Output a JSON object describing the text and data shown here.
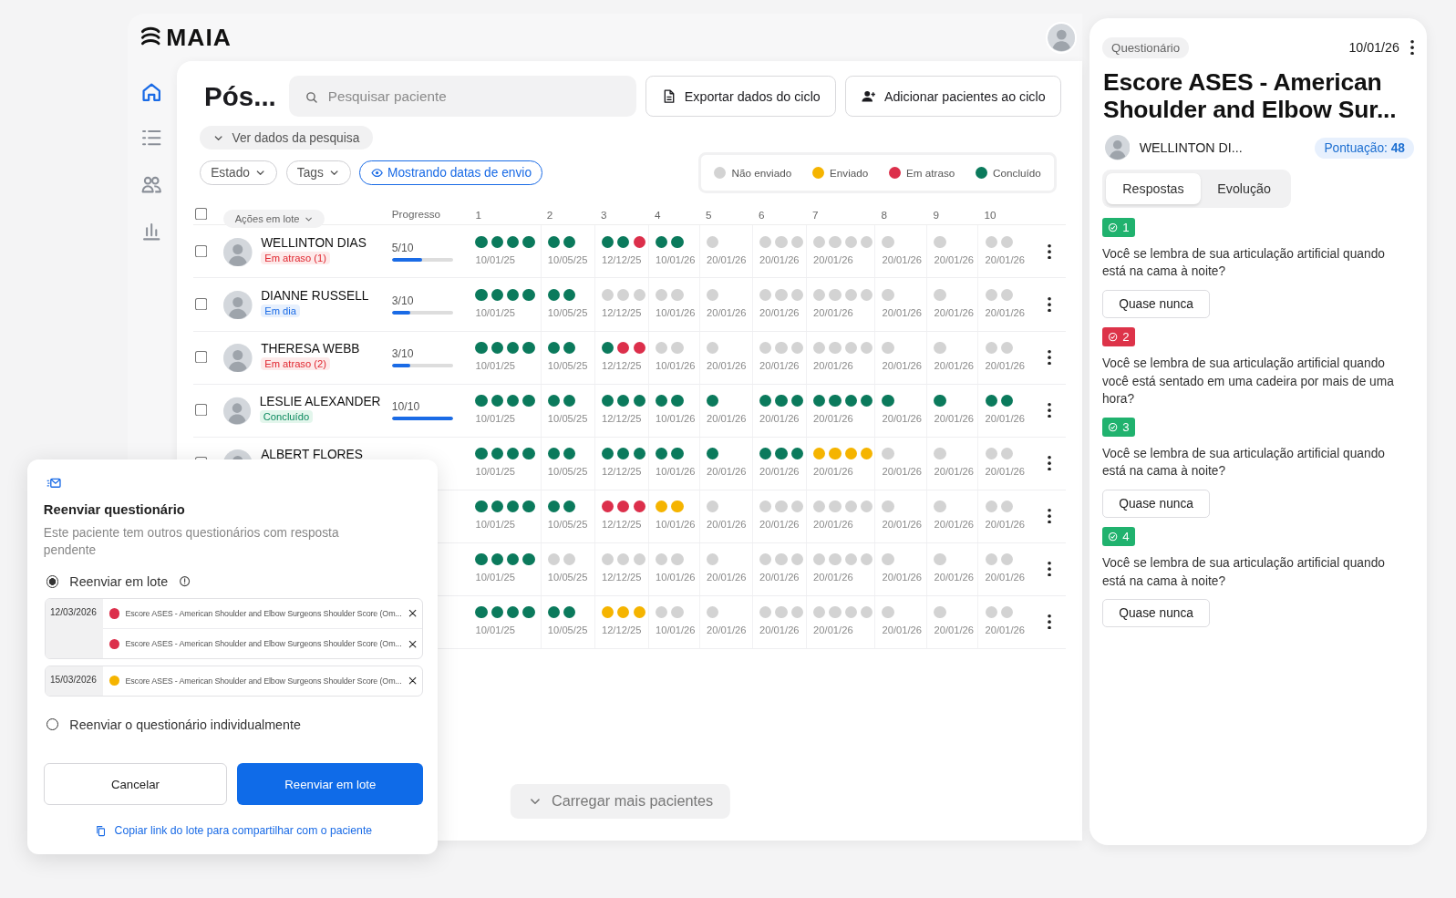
{
  "app": {
    "brand": "MAIA",
    "nav": [
      {
        "kind": "home",
        "selected": true
      },
      {
        "kind": "list",
        "selected": false
      },
      {
        "kind": "users",
        "selected": false
      },
      {
        "kind": "chart",
        "selected": false
      }
    ]
  },
  "main": {
    "title": "Pós...",
    "search": {
      "placeholder": "Pesquisar paciente"
    },
    "actions": [
      {
        "kind": "export",
        "label": "Exportar dados do ciclo"
      },
      {
        "kind": "add",
        "label": "Adicionar pacientes ao ciclo"
      }
    ],
    "survey_toggle": "Ver dados da pesquisa",
    "filters": [
      {
        "kind": "dropdown",
        "label": "Estado",
        "selected": false
      },
      {
        "kind": "dropdown",
        "label": "Tags",
        "selected": false
      },
      {
        "kind": "toggle",
        "label": "Mostrando datas de envio",
        "selected": true
      }
    ],
    "legend": [
      {
        "kind": "none",
        "label": "Não enviado",
        "color": "#d3d3d3"
      },
      {
        "kind": "sent",
        "label": "Enviado",
        "color": "#f5b400"
      },
      {
        "kind": "late",
        "label": "Em atraso",
        "color": "#dc2f4b"
      },
      {
        "kind": "done",
        "label": "Concluído",
        "color": "#0b7a5c"
      }
    ],
    "table": {
      "bulk_checked": false,
      "bulk_actions": "Ações em lote",
      "progress_header": "Progresso",
      "steps": [
        "1",
        "2",
        "3",
        "4",
        "5",
        "6",
        "7",
        "8",
        "9",
        "10"
      ],
      "rows": [
        {
          "name": "WELLINTON DIAS",
          "checked": false,
          "status": {
            "kind": "late",
            "label": "Em atraso (1)"
          },
          "progress": {
            "text": "5/10",
            "level": 0.5
          },
          "cells": [
            {
              "date": "10/01/25",
              "dots": [
                {
                  "kind": "done"
                },
                {
                  "kind": "done"
                },
                {
                  "kind": "done"
                },
                {
                  "kind": "done"
                }
              ]
            },
            {
              "date": "10/05/25",
              "dots": [
                {
                  "kind": "done"
                },
                {
                  "kind": "done"
                }
              ]
            },
            {
              "date": "12/12/25",
              "dots": [
                {
                  "kind": "done"
                },
                {
                  "kind": "done"
                },
                {
                  "kind": "late"
                }
              ]
            },
            {
              "date": "10/01/26",
              "dots": [
                {
                  "kind": "done"
                },
                {
                  "kind": "done"
                }
              ]
            },
            {
              "date": "20/01/26",
              "dots": [
                {
                  "kind": "none"
                }
              ]
            },
            {
              "date": "20/01/26",
              "dots": [
                {
                  "kind": "none"
                },
                {
                  "kind": "none"
                },
                {
                  "kind": "none"
                }
              ]
            },
            {
              "date": "20/01/26",
              "dots": [
                {
                  "kind": "none"
                },
                {
                  "kind": "none"
                },
                {
                  "kind": "none"
                },
                {
                  "kind": "none"
                }
              ]
            },
            {
              "date": "20/01/26",
              "dots": [
                {
                  "kind": "none"
                }
              ]
            },
            {
              "date": "20/01/26",
              "dots": [
                {
                  "kind": "none"
                }
              ]
            },
            {
              "date": "20/01/26",
              "dots": [
                {
                  "kind": "none"
                },
                {
                  "kind": "none"
                }
              ]
            }
          ]
        },
        {
          "name": "DIANNE RUSSELL",
          "checked": false,
          "status": {
            "kind": "on_time",
            "label": "Em dia"
          },
          "progress": {
            "text": "3/10",
            "level": 0.3
          },
          "cells": [
            {
              "date": "10/01/25",
              "dots": [
                {
                  "kind": "done"
                },
                {
                  "kind": "done"
                },
                {
                  "kind": "done"
                },
                {
                  "kind": "done"
                }
              ]
            },
            {
              "date": "10/05/25",
              "dots": [
                {
                  "kind": "done"
                },
                {
                  "kind": "done"
                }
              ]
            },
            {
              "date": "12/12/25",
              "dots": [
                {
                  "kind": "none"
                },
                {
                  "kind": "none"
                },
                {
                  "kind": "none"
                }
              ]
            },
            {
              "date": "10/01/26",
              "dots": [
                {
                  "kind": "none"
                },
                {
                  "kind": "none"
                }
              ]
            },
            {
              "date": "20/01/26",
              "dots": [
                {
                  "kind": "none"
                }
              ]
            },
            {
              "date": "20/01/26",
              "dots": [
                {
                  "kind": "none"
                },
                {
                  "kind": "none"
                },
                {
                  "kind": "none"
                }
              ]
            },
            {
              "date": "20/01/26",
              "dots": [
                {
                  "kind": "none"
                },
                {
                  "kind": "none"
                },
                {
                  "kind": "none"
                },
                {
                  "kind": "none"
                }
              ]
            },
            {
              "date": "20/01/26",
              "dots": [
                {
                  "kind": "none"
                }
              ]
            },
            {
              "date": "20/01/26",
              "dots": [
                {
                  "kind": "none"
                }
              ]
            },
            {
              "date": "20/01/26",
              "dots": [
                {
                  "kind": "none"
                },
                {
                  "kind": "none"
                }
              ]
            }
          ]
        },
        {
          "name": "THERESA WEBB",
          "checked": false,
          "status": {
            "kind": "late",
            "label": "Em atraso (2)"
          },
          "progress": {
            "text": "3/10",
            "level": 0.3
          },
          "cells": [
            {
              "date": "10/01/25",
              "dots": [
                {
                  "kind": "done"
                },
                {
                  "kind": "done"
                },
                {
                  "kind": "done"
                },
                {
                  "kind": "done"
                }
              ]
            },
            {
              "date": "10/05/25",
              "dots": [
                {
                  "kind": "done"
                },
                {
                  "kind": "done"
                }
              ]
            },
            {
              "date": "12/12/25",
              "dots": [
                {
                  "kind": "done"
                },
                {
                  "kind": "late"
                },
                {
                  "kind": "late"
                }
              ]
            },
            {
              "date": "10/01/26",
              "dots": [
                {
                  "kind": "none"
                },
                {
                  "kind": "none"
                }
              ]
            },
            {
              "date": "20/01/26",
              "dots": [
                {
                  "kind": "none"
                }
              ]
            },
            {
              "date": "20/01/26",
              "dots": [
                {
                  "kind": "none"
                },
                {
                  "kind": "none"
                },
                {
                  "kind": "none"
                }
              ]
            },
            {
              "date": "20/01/26",
              "dots": [
                {
                  "kind": "none"
                },
                {
                  "kind": "none"
                },
                {
                  "kind": "none"
                },
                {
                  "kind": "none"
                }
              ]
            },
            {
              "date": "20/01/26",
              "dots": [
                {
                  "kind": "none"
                }
              ]
            },
            {
              "date": "20/01/26",
              "dots": [
                {
                  "kind": "none"
                }
              ]
            },
            {
              "date": "20/01/26",
              "dots": [
                {
                  "kind": "none"
                },
                {
                  "kind": "none"
                }
              ]
            }
          ]
        },
        {
          "name": "LESLIE ALEXANDER",
          "checked": false,
          "status": {
            "kind": "done",
            "label": "Concluído"
          },
          "progress": {
            "text": "10/10",
            "level": 1
          },
          "cells": [
            {
              "date": "10/01/25",
              "dots": [
                {
                  "kind": "done"
                },
                {
                  "kind": "done"
                },
                {
                  "kind": "done"
                },
                {
                  "kind": "done"
                }
              ]
            },
            {
              "date": "10/05/25",
              "dots": [
                {
                  "kind": "done"
                },
                {
                  "kind": "done"
                }
              ]
            },
            {
              "date": "12/12/25",
              "dots": [
                {
                  "kind": "done"
                },
                {
                  "kind": "done"
                },
                {
                  "kind": "done"
                }
              ]
            },
            {
              "date": "10/01/26",
              "dots": [
                {
                  "kind": "done"
                },
                {
                  "kind": "done"
                }
              ]
            },
            {
              "date": "20/01/26",
              "dots": [
                {
                  "kind": "done"
                }
              ]
            },
            {
              "date": "20/01/26",
              "dots": [
                {
                  "kind": "done"
                },
                {
                  "kind": "done"
                },
                {
                  "kind": "done"
                }
              ]
            },
            {
              "date": "20/01/26",
              "dots": [
                {
                  "kind": "done"
                },
                {
                  "kind": "done"
                },
                {
                  "kind": "done"
                },
                {
                  "kind": "done"
                }
              ]
            },
            {
              "date": "20/01/26",
              "dots": [
                {
                  "kind": "done"
                }
              ]
            },
            {
              "date": "20/01/26",
              "dots": [
                {
                  "kind": "done"
                }
              ]
            },
            {
              "date": "20/01/26",
              "dots": [
                {
                  "kind": "done"
                },
                {
                  "kind": "done"
                }
              ]
            }
          ]
        },
        {
          "name": "ALBERT FLORES",
          "checked": false,
          "cells": [
            {
              "date": "10/01/25",
              "dots": [
                {
                  "kind": "done"
                },
                {
                  "kind": "done"
                },
                {
                  "kind": "done"
                },
                {
                  "kind": "done"
                }
              ]
            },
            {
              "date": "10/05/25",
              "dots": [
                {
                  "kind": "done"
                },
                {
                  "kind": "done"
                }
              ]
            },
            {
              "date": "12/12/25",
              "dots": [
                {
                  "kind": "done"
                },
                {
                  "kind": "done"
                },
                {
                  "kind": "done"
                }
              ]
            },
            {
              "date": "10/01/26",
              "dots": [
                {
                  "kind": "done"
                },
                {
                  "kind": "done"
                }
              ]
            },
            {
              "date": "20/01/26",
              "dots": [
                {
                  "kind": "done"
                }
              ]
            },
            {
              "date": "20/01/26",
              "dots": [
                {
                  "kind": "done"
                },
                {
                  "kind": "done"
                },
                {
                  "kind": "done"
                }
              ]
            },
            {
              "date": "20/01/26",
              "dots": [
                {
                  "kind": "sent"
                },
                {
                  "kind": "sent"
                },
                {
                  "kind": "sent"
                },
                {
                  "kind": "sent"
                }
              ]
            },
            {
              "date": "20/01/26",
              "dots": [
                {
                  "kind": "none"
                }
              ]
            },
            {
              "date": "20/01/26",
              "dots": [
                {
                  "kind": "none"
                }
              ]
            },
            {
              "date": "20/01/26",
              "dots": [
                {
                  "kind": "none"
                },
                {
                  "kind": "none"
                }
              ]
            }
          ]
        },
        {
          "cells": [
            {
              "date": "10/01/25",
              "dots": [
                {
                  "kind": "done"
                },
                {
                  "kind": "done"
                },
                {
                  "kind": "done"
                },
                {
                  "kind": "done"
                }
              ]
            },
            {
              "date": "10/05/25",
              "dots": [
                {
                  "kind": "done"
                },
                {
                  "kind": "done"
                }
              ]
            },
            {
              "date": "12/12/25",
              "dots": [
                {
                  "kind": "late"
                },
                {
                  "kind": "late"
                },
                {
                  "kind": "late"
                }
              ]
            },
            {
              "date": "10/01/26",
              "dots": [
                {
                  "kind": "sent"
                },
                {
                  "kind": "sent"
                }
              ]
            },
            {
              "date": "20/01/26",
              "dots": [
                {
                  "kind": "none"
                }
              ]
            },
            {
              "date": "20/01/26",
              "dots": [
                {
                  "kind": "none"
                },
                {
                  "kind": "none"
                },
                {
                  "kind": "none"
                }
              ]
            },
            {
              "date": "20/01/26",
              "dots": [
                {
                  "kind": "none"
                },
                {
                  "kind": "none"
                },
                {
                  "kind": "none"
                },
                {
                  "kind": "none"
                }
              ]
            },
            {
              "date": "20/01/26",
              "dots": [
                {
                  "kind": "none"
                }
              ]
            },
            {
              "date": "20/01/26",
              "dots": [
                {
                  "kind": "none"
                }
              ]
            },
            {
              "date": "20/01/26",
              "dots": [
                {
                  "kind": "none"
                },
                {
                  "kind": "none"
                }
              ]
            }
          ]
        },
        {
          "cells": [
            {
              "date": "10/01/25",
              "dots": [
                {
                  "kind": "done"
                },
                {
                  "kind": "done"
                },
                {
                  "kind": "done"
                },
                {
                  "kind": "done"
                }
              ]
            },
            {
              "date": "10/05/25",
              "dots": [
                {
                  "kind": "none"
                },
                {
                  "kind": "none"
                }
              ]
            },
            {
              "date": "12/12/25",
              "dots": [
                {
                  "kind": "none"
                },
                {
                  "kind": "none"
                },
                {
                  "kind": "none"
                }
              ]
            },
            {
              "date": "10/01/26",
              "dots": [
                {
                  "kind": "none"
                },
                {
                  "kind": "none"
                }
              ]
            },
            {
              "date": "20/01/26",
              "dots": [
                {
                  "kind": "none"
                }
              ]
            },
            {
              "date": "20/01/26",
              "dots": [
                {
                  "kind": "none"
                },
                {
                  "kind": "none"
                },
                {
                  "kind": "none"
                }
              ]
            },
            {
              "date": "20/01/26",
              "dots": [
                {
                  "kind": "none"
                },
                {
                  "kind": "none"
                },
                {
                  "kind": "none"
                },
                {
                  "kind": "none"
                }
              ]
            },
            {
              "date": "20/01/26",
              "dots": [
                {
                  "kind": "none"
                }
              ]
            },
            {
              "date": "20/01/26",
              "dots": [
                {
                  "kind": "none"
                }
              ]
            },
            {
              "date": "20/01/26",
              "dots": [
                {
                  "kind": "none"
                },
                {
                  "kind": "none"
                }
              ]
            }
          ]
        },
        {
          "cells": [
            {
              "date": "10/01/25",
              "dots": [
                {
                  "kind": "done"
                },
                {
                  "kind": "done"
                },
                {
                  "kind": "done"
                },
                {
                  "kind": "done"
                }
              ]
            },
            {
              "date": "10/05/25",
              "dots": [
                {
                  "kind": "done"
                },
                {
                  "kind": "done"
                }
              ]
            },
            {
              "date": "12/12/25",
              "dots": [
                {
                  "kind": "sent"
                },
                {
                  "kind": "sent"
                },
                {
                  "kind": "sent"
                }
              ]
            },
            {
              "date": "10/01/26",
              "dots": [
                {
                  "kind": "none"
                },
                {
                  "kind": "none"
                }
              ]
            },
            {
              "date": "20/01/26",
              "dots": [
                {
                  "kind": "none"
                }
              ]
            },
            {
              "date": "20/01/26",
              "dots": [
                {
                  "kind": "none"
                },
                {
                  "kind": "none"
                },
                {
                  "kind": "none"
                }
              ]
            },
            {
              "date": "20/01/26",
              "dots": [
                {
                  "kind": "none"
                },
                {
                  "kind": "none"
                },
                {
                  "kind": "none"
                },
                {
                  "kind": "none"
                }
              ]
            },
            {
              "date": "20/01/26",
              "dots": [
                {
                  "kind": "none"
                }
              ]
            },
            {
              "date": "20/01/26",
              "dots": [
                {
                  "kind": "none"
                }
              ]
            },
            {
              "date": "20/01/26",
              "dots": [
                {
                  "kind": "none"
                },
                {
                  "kind": "none"
                }
              ]
            }
          ]
        }
      ]
    },
    "load_more": "Carregar mais pacientes"
  },
  "popup": {
    "title": "Reenviar questionário",
    "description": "Este paciente tem outros questionários com resposta pendente",
    "options": [
      {
        "label": "Reenviar em lote",
        "selected": true,
        "info": true,
        "groups": [
          {
            "date": "12/03/2026",
            "items": [
              {
                "kind": "late",
                "text": "Escore ASES - American Shoulder and Elbow Surgeons Shoulder Score (Om..."
              },
              {
                "kind": "late",
                "text": "Escore ASES - American Shoulder and Elbow Surgeons Shoulder Score (Om..."
              }
            ]
          },
          {
            "date": "15/03/2026",
            "items": [
              {
                "kind": "sent",
                "text": "Escore ASES - American Shoulder and Elbow Surgeons Shoulder Score (Om..."
              }
            ]
          }
        ]
      },
      {
        "label": "Reenviar o questionário individualmente",
        "selected": false,
        "info": false
      }
    ],
    "cancel": "Cancelar",
    "confirm": "Reenviar em lote",
    "copy_link": "Copiar link do lote para compartilhar com o paciente"
  },
  "panel": {
    "tag": "Questionário",
    "date": "10/01/26",
    "title": "Escore ASES - American Shoulder and Elbow Sur...",
    "patient": "WELLINTON DI...",
    "score": "Pontuação: **48**",
    "tabs": [
      {
        "label": "Respostas",
        "selected": true
      },
      {
        "label": "Evolução",
        "selected": false
      }
    ],
    "questions": [
      {
        "kind": "ok",
        "number": "1",
        "text": "Você se lembra de sua articulação artificial quando está na cama à noite?",
        "answer": "Quase nunca"
      },
      {
        "kind": "alert",
        "number": "2",
        "text": "Você se lembra de sua articulação artificial quando você está sentado em uma cadeira por mais de uma hora?"
      },
      {
        "kind": "ok",
        "number": "3",
        "text": "Você se lembra de sua articulação artificial quando está na cama à noite?",
        "answer": "Quase nunca"
      },
      {
        "kind": "ok",
        "number": "4",
        "text": "Você se lembra de sua articulação artificial quando está na cama à noite?",
        "answer": "Quase nunca"
      }
    ]
  }
}
